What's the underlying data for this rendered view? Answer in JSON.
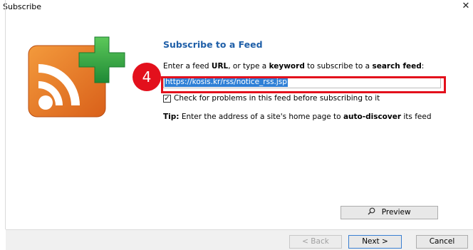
{
  "window": {
    "title": "Subscribe",
    "close_glyph": "✕"
  },
  "content": {
    "heading": "Subscribe to a Feed",
    "instruction": {
      "part1": "Enter a feed ",
      "url_word": "URL",
      "part2": ", or type a ",
      "keyword_word": "keyword",
      "part3": " to subscribe to a ",
      "search_feed_word": "search feed",
      "part4": ":"
    },
    "url_value": "https://kosis.kr/rss/notice_rss.jsp",
    "checkbox": {
      "checked": true,
      "label": "Check for problems in this feed before subscribing to it"
    },
    "tip": {
      "prefix": "Tip:",
      "part1": " Enter the address of a site's home page to ",
      "bold": "auto-discover",
      "part2": " its feed"
    }
  },
  "annotation": {
    "step_number": "4",
    "color": "#e3101c"
  },
  "buttons": {
    "preview": "Preview",
    "back": "< Back",
    "next": "Next >",
    "cancel": "Cancel"
  },
  "icons": {
    "logo": "rss-plus-icon",
    "preview": "search-icon",
    "close": "close-icon"
  },
  "colors": {
    "heading": "#1f5fa8",
    "rss_orange": "#e8741f",
    "plus_green": "#2fa84a",
    "selection": "#2e7fd6"
  }
}
